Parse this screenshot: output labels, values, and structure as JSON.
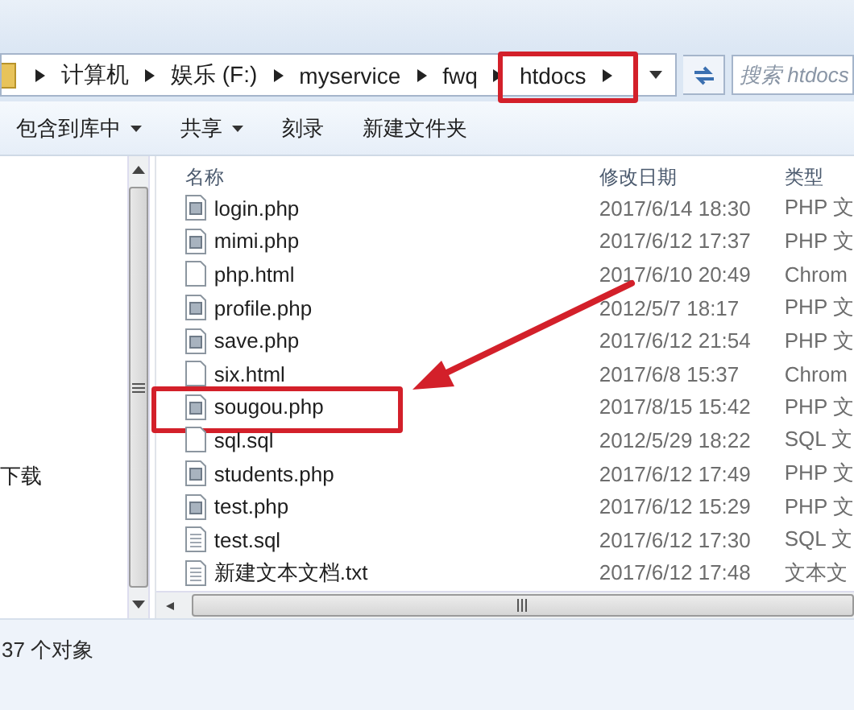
{
  "address_bar": {
    "crumbs": [
      {
        "label": "计算机",
        "annotated": false
      },
      {
        "label": "娱乐 (F:)",
        "annotated": false
      },
      {
        "label": "myservice",
        "annotated": false
      },
      {
        "label": "fwq",
        "annotated": false
      },
      {
        "label": "htdocs",
        "annotated": true
      }
    ]
  },
  "search": {
    "placeholder": "搜索 htdocs"
  },
  "toolbar": [
    {
      "label": "包含到库中",
      "has_menu": true
    },
    {
      "label": "共享",
      "has_menu": true
    },
    {
      "label": "刻录",
      "has_menu": false
    },
    {
      "label": "新建文件夹",
      "has_menu": false
    }
  ],
  "nav": {
    "items": [
      "下载"
    ]
  },
  "columns": [
    "名称",
    "修改日期",
    "类型"
  ],
  "files": [
    {
      "name": "login.php",
      "date": "2017/6/14 18:30",
      "type": "PHP 文",
      "kind": "script",
      "annotated": false
    },
    {
      "name": "mimi.php",
      "date": "2017/6/12 17:37",
      "type": "PHP 文",
      "kind": "script",
      "annotated": false
    },
    {
      "name": "php.html",
      "date": "2017/6/10 20:49",
      "type": "Chrom",
      "kind": "blank",
      "annotated": false
    },
    {
      "name": "profile.php",
      "date": "2012/5/7 18:17",
      "type": "PHP 文",
      "kind": "script",
      "annotated": false
    },
    {
      "name": "save.php",
      "date": "2017/6/12 21:54",
      "type": "PHP 文",
      "kind": "script",
      "annotated": false
    },
    {
      "name": "six.html",
      "date": "2017/6/8 15:37",
      "type": "Chrom",
      "kind": "blank",
      "annotated": false
    },
    {
      "name": "sougou.php",
      "date": "2017/8/15 15:42",
      "type": "PHP 文",
      "kind": "script",
      "annotated": true
    },
    {
      "name": "sql.sql",
      "date": "2012/5/29 18:22",
      "type": "SQL 文",
      "kind": "blank",
      "annotated": false
    },
    {
      "name": "students.php",
      "date": "2017/6/12 17:49",
      "type": "PHP 文",
      "kind": "script",
      "annotated": false
    },
    {
      "name": "test.php",
      "date": "2017/6/12 15:29",
      "type": "PHP 文",
      "kind": "script",
      "annotated": false
    },
    {
      "name": "test.sql",
      "date": "2017/6/12 17:30",
      "type": "SQL 文",
      "kind": "text",
      "annotated": false
    },
    {
      "name": "新建文本文档.txt",
      "date": "2017/6/12 17:48",
      "type": "文本文",
      "kind": "text",
      "annotated": false
    }
  ],
  "status_bar": {
    "count": "37 个对象"
  }
}
